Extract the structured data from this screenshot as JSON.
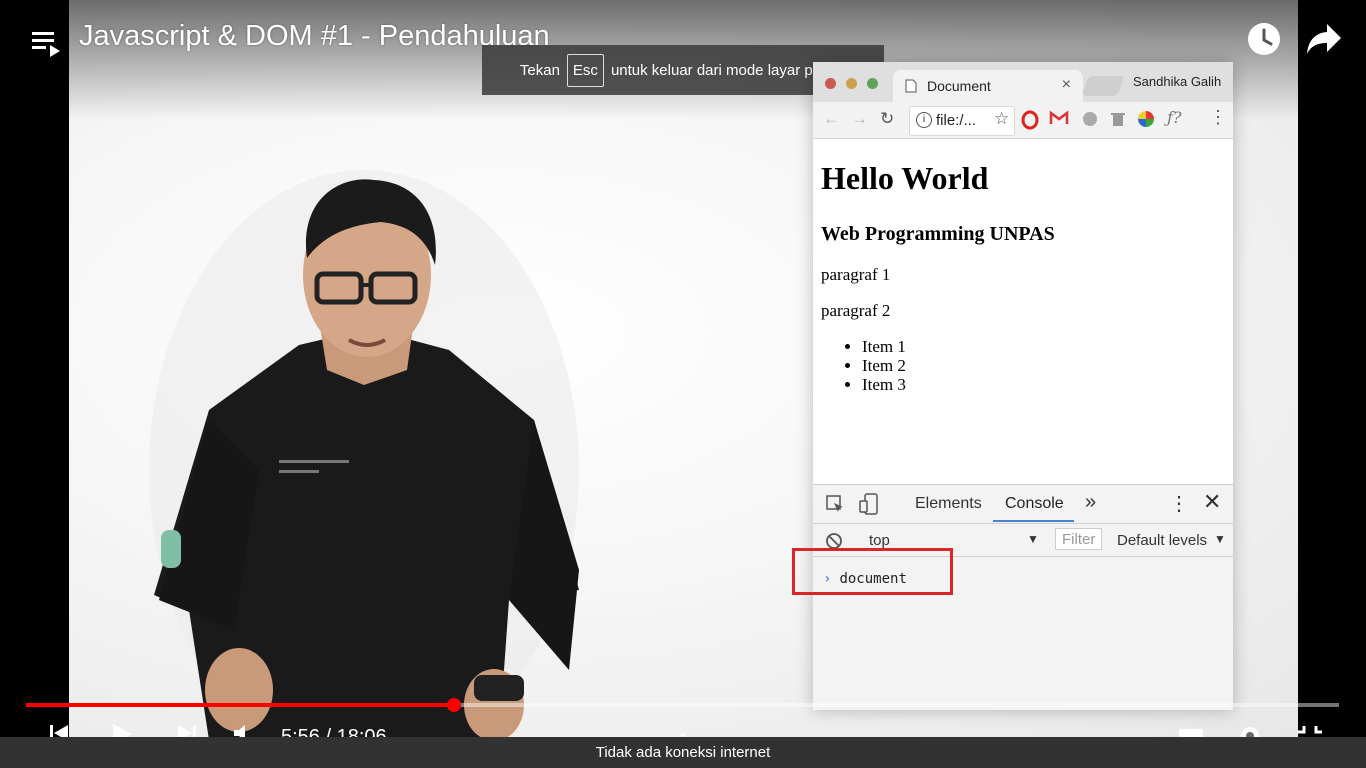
{
  "video": {
    "title": "Javascript & DOM #1 - Pendahuluan",
    "time_display": "5:56 / 18:06",
    "progress_fraction": 0.326
  },
  "fullscreen_toast": {
    "prefix": "Tekan",
    "key": "Esc",
    "suffix": "untuk keluar dari mode layar penuh"
  },
  "browser": {
    "tab_title": "Document",
    "tab_close": "×",
    "profile_name": "Sandhika Galih",
    "url": "file:/...",
    "page": {
      "h1": "Hello World",
      "h3": "Web Programming UNPAS",
      "paragraphs": [
        "paragraf 1",
        "paragraf 2"
      ],
      "items": [
        "Item 1",
        "Item 2",
        "Item 3"
      ]
    },
    "devtools": {
      "tabs": [
        "Elements",
        "Console"
      ],
      "more": "»",
      "context": "top",
      "filter_placeholder": "Filter",
      "levels": "Default levels",
      "console_input": "document"
    }
  },
  "status": {
    "offline_message": "Tidak ada koneksi internet"
  },
  "colors": {
    "progress": "#ff0000",
    "highlight": "#d8262b",
    "console_tab_accent": "#4a82d8"
  }
}
